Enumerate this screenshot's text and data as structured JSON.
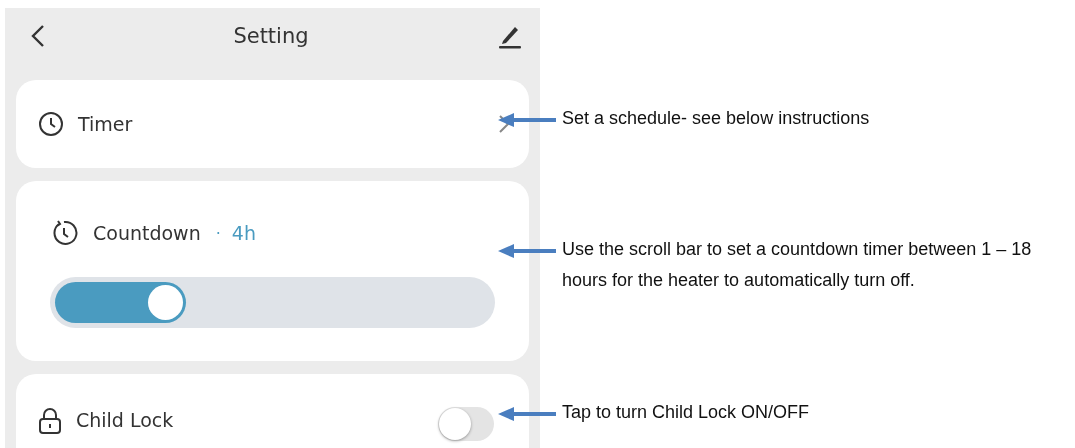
{
  "header": {
    "title": "Setting"
  },
  "timer": {
    "label": "Timer"
  },
  "countdown": {
    "label": "Countdown",
    "separator": "·",
    "value": "4h",
    "level": 0.3
  },
  "child_lock": {
    "label": "Child Lock",
    "on": false
  },
  "annotations": [
    {
      "text": "Set a schedule- see below instructions"
    },
    {
      "text": "Use the scroll bar to set a countdown timer between 1 – 18 hours for the heater to automatically turn off."
    },
    {
      "text": "Tap to turn Child Lock ON/OFF"
    }
  ]
}
